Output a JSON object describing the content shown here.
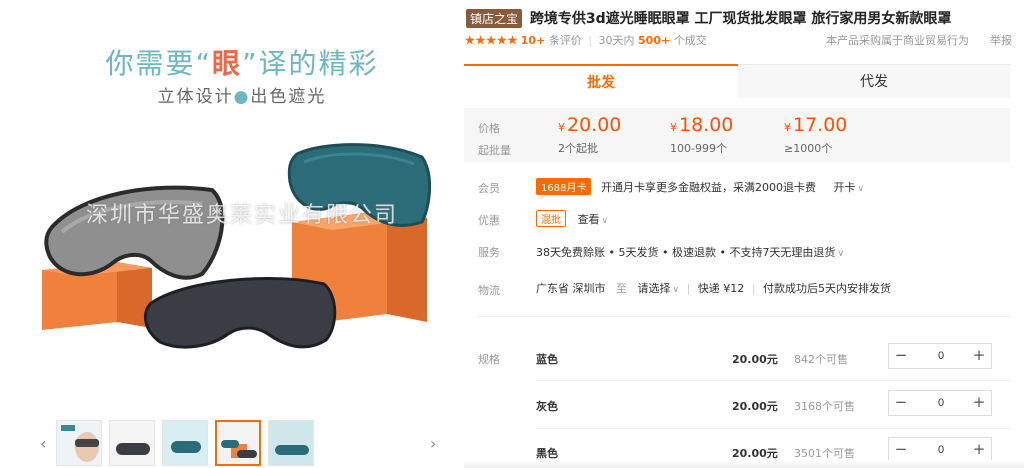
{
  "hero": {
    "title_a": "你需要“",
    "title_b": "眼",
    "title_c": "”译的精彩",
    "subtitle_a": "立体设计",
    "subtitle_dot": "●",
    "subtitle_b": "出色遮光",
    "watermark": "深圳市华盛奥莱实业有限公司"
  },
  "thumbs": {
    "prev": "‹",
    "next": "›",
    "count": 5,
    "active_index": 3
  },
  "product": {
    "shop_badge": "镇店之宝",
    "title": "跨境专供3d遮光睡眠眼罩 工厂现货批发眼罩 旅行家用男女新款眼罩",
    "stars": "★★★★★",
    "reviews_count": "10+",
    "reviews_label": "条评价",
    "sep": "|",
    "sold_prefix": "30天内",
    "sold_count": "500+",
    "sold_suffix": "个成交",
    "notice": "本产品采购属于商业贸易行为",
    "report": "举报"
  },
  "tabs": {
    "wholesale": "批发",
    "dropship": "代发"
  },
  "pricing": {
    "price_label": "价格",
    "moq_label": "起批量",
    "yen": "¥",
    "tiers": [
      {
        "price": "20.00",
        "qty": "2个起批"
      },
      {
        "price": "18.00",
        "qty": "100-999个"
      },
      {
        "price": "17.00",
        "qty": "≥1000个"
      }
    ]
  },
  "member": {
    "label": "会员",
    "badge": "1688月卡",
    "text": "开通月卡享更多金融权益，采满2000退卡费",
    "action": "开卡"
  },
  "discount": {
    "label": "优惠",
    "badge": "混批",
    "action": "查看"
  },
  "service": {
    "label": "服务",
    "text": "38天免费赊账 • 5天发货 • 极速退款 • 不支持7天无理由退货"
  },
  "logistics": {
    "label": "物流",
    "from": "广东省 深圳市",
    "to_label": "至",
    "select": "请选择",
    "express": "快递 ¥12",
    "note": "付款成功后5天内安排发货",
    "bar": "|"
  },
  "sku": {
    "label": "规格",
    "minus": "−",
    "plus": "+",
    "rows": [
      {
        "name": "蓝色",
        "price": "20.00元",
        "stock": "842个可售",
        "qty": "0"
      },
      {
        "name": "灰色",
        "price": "20.00元",
        "stock": "3168个可售",
        "qty": "0"
      },
      {
        "name": "黑色",
        "price": "20.00元",
        "stock": "3501个可售",
        "qty": "0"
      }
    ]
  },
  "colors": {
    "accent": "#ff6a00",
    "price": "#ff5000",
    "teal": "#6cb7c1",
    "badge_brown": "#8a5a3c"
  }
}
